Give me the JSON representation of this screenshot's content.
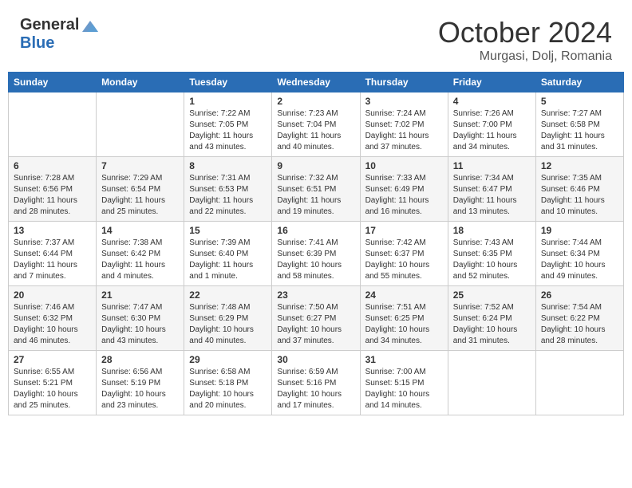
{
  "header": {
    "logo_general": "General",
    "logo_blue": "Blue",
    "month_title": "October 2024",
    "location": "Murgasi, Dolj, Romania"
  },
  "days_of_week": [
    "Sunday",
    "Monday",
    "Tuesday",
    "Wednesday",
    "Thursday",
    "Friday",
    "Saturday"
  ],
  "weeks": [
    [
      {
        "day": "",
        "info": ""
      },
      {
        "day": "",
        "info": ""
      },
      {
        "day": "1",
        "info": "Sunrise: 7:22 AM\nSunset: 7:05 PM\nDaylight: 11 hours and 43 minutes."
      },
      {
        "day": "2",
        "info": "Sunrise: 7:23 AM\nSunset: 7:04 PM\nDaylight: 11 hours and 40 minutes."
      },
      {
        "day": "3",
        "info": "Sunrise: 7:24 AM\nSunset: 7:02 PM\nDaylight: 11 hours and 37 minutes."
      },
      {
        "day": "4",
        "info": "Sunrise: 7:26 AM\nSunset: 7:00 PM\nDaylight: 11 hours and 34 minutes."
      },
      {
        "day": "5",
        "info": "Sunrise: 7:27 AM\nSunset: 6:58 PM\nDaylight: 11 hours and 31 minutes."
      }
    ],
    [
      {
        "day": "6",
        "info": "Sunrise: 7:28 AM\nSunset: 6:56 PM\nDaylight: 11 hours and 28 minutes."
      },
      {
        "day": "7",
        "info": "Sunrise: 7:29 AM\nSunset: 6:54 PM\nDaylight: 11 hours and 25 minutes."
      },
      {
        "day": "8",
        "info": "Sunrise: 7:31 AM\nSunset: 6:53 PM\nDaylight: 11 hours and 22 minutes."
      },
      {
        "day": "9",
        "info": "Sunrise: 7:32 AM\nSunset: 6:51 PM\nDaylight: 11 hours and 19 minutes."
      },
      {
        "day": "10",
        "info": "Sunrise: 7:33 AM\nSunset: 6:49 PM\nDaylight: 11 hours and 16 minutes."
      },
      {
        "day": "11",
        "info": "Sunrise: 7:34 AM\nSunset: 6:47 PM\nDaylight: 11 hours and 13 minutes."
      },
      {
        "day": "12",
        "info": "Sunrise: 7:35 AM\nSunset: 6:46 PM\nDaylight: 11 hours and 10 minutes."
      }
    ],
    [
      {
        "day": "13",
        "info": "Sunrise: 7:37 AM\nSunset: 6:44 PM\nDaylight: 11 hours and 7 minutes."
      },
      {
        "day": "14",
        "info": "Sunrise: 7:38 AM\nSunset: 6:42 PM\nDaylight: 11 hours and 4 minutes."
      },
      {
        "day": "15",
        "info": "Sunrise: 7:39 AM\nSunset: 6:40 PM\nDaylight: 11 hours and 1 minute."
      },
      {
        "day": "16",
        "info": "Sunrise: 7:41 AM\nSunset: 6:39 PM\nDaylight: 10 hours and 58 minutes."
      },
      {
        "day": "17",
        "info": "Sunrise: 7:42 AM\nSunset: 6:37 PM\nDaylight: 10 hours and 55 minutes."
      },
      {
        "day": "18",
        "info": "Sunrise: 7:43 AM\nSunset: 6:35 PM\nDaylight: 10 hours and 52 minutes."
      },
      {
        "day": "19",
        "info": "Sunrise: 7:44 AM\nSunset: 6:34 PM\nDaylight: 10 hours and 49 minutes."
      }
    ],
    [
      {
        "day": "20",
        "info": "Sunrise: 7:46 AM\nSunset: 6:32 PM\nDaylight: 10 hours and 46 minutes."
      },
      {
        "day": "21",
        "info": "Sunrise: 7:47 AM\nSunset: 6:30 PM\nDaylight: 10 hours and 43 minutes."
      },
      {
        "day": "22",
        "info": "Sunrise: 7:48 AM\nSunset: 6:29 PM\nDaylight: 10 hours and 40 minutes."
      },
      {
        "day": "23",
        "info": "Sunrise: 7:50 AM\nSunset: 6:27 PM\nDaylight: 10 hours and 37 minutes."
      },
      {
        "day": "24",
        "info": "Sunrise: 7:51 AM\nSunset: 6:25 PM\nDaylight: 10 hours and 34 minutes."
      },
      {
        "day": "25",
        "info": "Sunrise: 7:52 AM\nSunset: 6:24 PM\nDaylight: 10 hours and 31 minutes."
      },
      {
        "day": "26",
        "info": "Sunrise: 7:54 AM\nSunset: 6:22 PM\nDaylight: 10 hours and 28 minutes."
      }
    ],
    [
      {
        "day": "27",
        "info": "Sunrise: 6:55 AM\nSunset: 5:21 PM\nDaylight: 10 hours and 25 minutes."
      },
      {
        "day": "28",
        "info": "Sunrise: 6:56 AM\nSunset: 5:19 PM\nDaylight: 10 hours and 23 minutes."
      },
      {
        "day": "29",
        "info": "Sunrise: 6:58 AM\nSunset: 5:18 PM\nDaylight: 10 hours and 20 minutes."
      },
      {
        "day": "30",
        "info": "Sunrise: 6:59 AM\nSunset: 5:16 PM\nDaylight: 10 hours and 17 minutes."
      },
      {
        "day": "31",
        "info": "Sunrise: 7:00 AM\nSunset: 5:15 PM\nDaylight: 10 hours and 14 minutes."
      },
      {
        "day": "",
        "info": ""
      },
      {
        "day": "",
        "info": ""
      }
    ]
  ]
}
